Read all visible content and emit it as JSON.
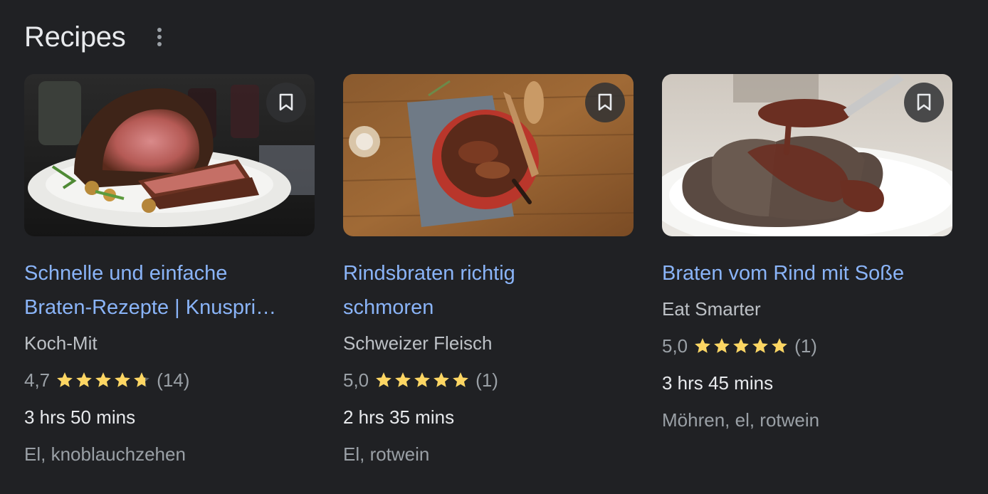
{
  "section": {
    "title": "Recipes"
  },
  "cards": [
    {
      "title_lines": [
        "Schnelle und einfache",
        "Braten-Rezepte | Knuspri…"
      ],
      "source": "Koch-Mit",
      "rating_value": "4,7",
      "rating_stars": 4.7,
      "rating_count": "(14)",
      "duration": "3 hrs 50 mins",
      "ingredients": "El, knoblauchzehen",
      "image_icon": "roast-beef-image"
    },
    {
      "title_lines": [
        "Rindsbraten richtig",
        "schmoren"
      ],
      "source": "Schweizer Fleisch",
      "rating_value": "5,0",
      "rating_stars": 5.0,
      "rating_count": "(1)",
      "duration": "2 hrs 35 mins",
      "ingredients": "El, rotwein",
      "image_icon": "braised-beef-pot-image"
    },
    {
      "title_lines": [
        "Braten vom Rind mit Soße"
      ],
      "source": "Eat Smarter",
      "rating_value": "5,0",
      "rating_stars": 5.0,
      "rating_count": "(1)",
      "duration": "3 hrs 45 mins",
      "ingredients": "Möhren, el, rotwein",
      "image_icon": "beef-with-gravy-image"
    }
  ],
  "colors": {
    "background": "#202124",
    "link": "#8ab4f8",
    "star": "#fdd663",
    "star_empty": "#5f6368"
  }
}
